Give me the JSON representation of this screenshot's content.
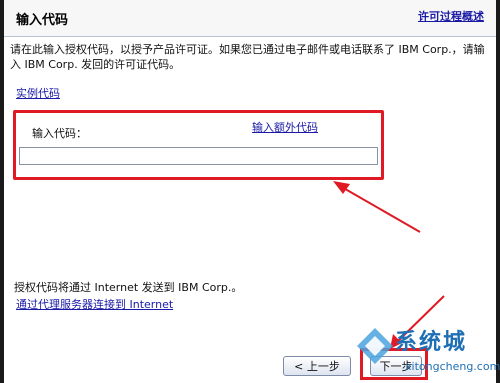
{
  "header": {
    "title": "输入代码",
    "help_link": "许可过程概述"
  },
  "intro": {
    "text": "请在此输入授权代码，以授予产品许可证。如果您已通过电子邮件或电话联系了 IBM Corp.，请输入 IBM Corp. 发回的许可证代码。"
  },
  "example_link": "实例代码",
  "code_section": {
    "label": "输入代码：",
    "extra_link": "输入额外代码",
    "input_value": ""
  },
  "footer": {
    "note": "授权代码将通过 Internet 发送到 IBM Corp.。",
    "proxy_link": "通过代理服务器连接到 Internet"
  },
  "buttons": {
    "prev": "< 上一步",
    "next": "下一步"
  },
  "watermark": {
    "cn": "系统城",
    "en": "xitongcheng.com"
  },
  "colors": {
    "highlight": "#e01a24",
    "link": "#1a1aa6",
    "watermark": "#1f6fb4"
  }
}
